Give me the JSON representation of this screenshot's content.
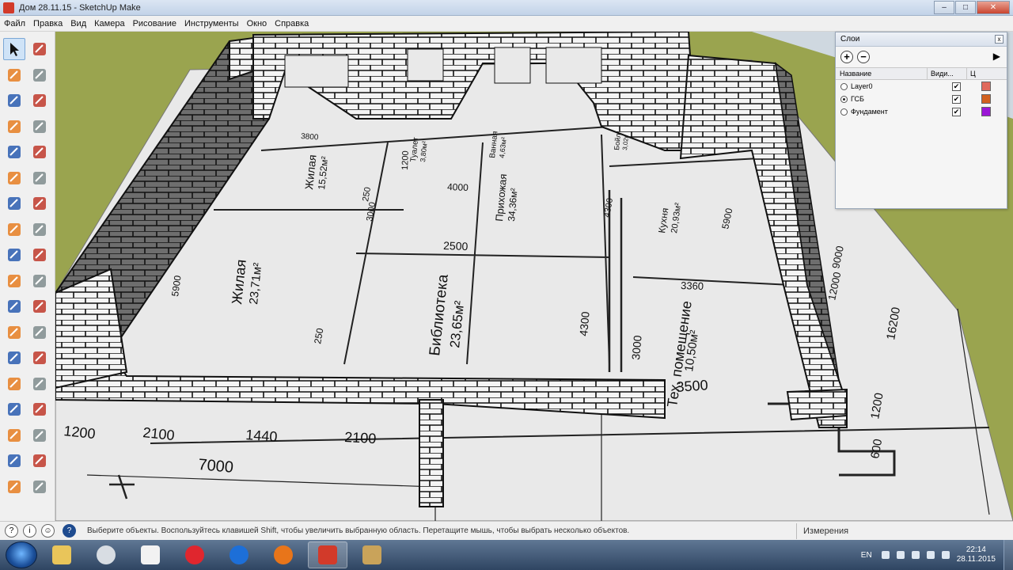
{
  "window": {
    "title": "Дом 28.11.15 - SketchUp Make",
    "buttons": [
      "–",
      "□",
      "✕"
    ]
  },
  "menu": [
    "Файл",
    "Правка",
    "Вид",
    "Камера",
    "Рисование",
    "Инструменты",
    "Окно",
    "Справка"
  ],
  "toolbar": {
    "tools": [
      "select-tool",
      "make-component-tool",
      "paint-bucket-tool",
      "eraser-tool",
      "line-tool",
      "freehand-tool",
      "rectangle-tool",
      "rotated-rectangle-tool",
      "circle-tool",
      "polygon-tool",
      "arc-tool",
      "pie-tool",
      "two-point-arc-tool",
      "three-point-arc-tool",
      "move-tool",
      "push-pull-tool",
      "rotate-tool",
      "follow-me-tool",
      "scale-tool",
      "offset-tool",
      "tape-measure-tool",
      "dimension-tool",
      "protractor-tool",
      "text-tool",
      "axes-tool",
      "3d-text-tool",
      "orbit-tool",
      "pan-tool",
      "zoom-tool",
      "zoom-window-tool",
      "zoom-extents-tool",
      "previous-view-tool",
      "position-camera-tool",
      "look-around-tool",
      "walk-tool",
      "section-plane-tool"
    ]
  },
  "plan": {
    "dims": [
      "1200",
      "2100",
      "1440",
      "2100",
      "7000",
      "3500",
      "1200",
      "600",
      "16200",
      "9000",
      "5900",
      "3360",
      "3000",
      "4300",
      "2500",
      "4000",
      "1200",
      "3800",
      "5900",
      "250",
      "250",
      "3000",
      "4300",
      "12000"
    ],
    "rooms": [
      {
        "name": "Жилая",
        "area": "15,52м²"
      },
      {
        "name": "Жилая",
        "area": "23,71м²"
      },
      {
        "name": "Библиотека",
        "area": "23,65м²"
      },
      {
        "name": "Прихожая",
        "area": "34,36м²"
      },
      {
        "name": "Кухня",
        "area": "20,93м²"
      },
      {
        "name": "Тех. помещение",
        "area": "10,50м²"
      },
      {
        "name": "Туалет",
        "area": "3,80м²"
      },
      {
        "name": "Ванная",
        "area": "4,63м²"
      },
      {
        "name": "Бойлер",
        "area": "3,02м²"
      }
    ]
  },
  "layers_panel": {
    "title": "Слои",
    "columns": {
      "name": "Название",
      "visible": "Види...",
      "color": "Ц"
    },
    "rows": [
      {
        "name": "Layer0",
        "active": false,
        "visible": "✔",
        "color": "#e06a5c"
      },
      {
        "name": "ГСБ",
        "active": true,
        "visible": "✔",
        "color": "#d2611f"
      },
      {
        "name": "Фундамент",
        "active": false,
        "visible": "✔",
        "color": "#9b16d6"
      }
    ]
  },
  "statusbar": {
    "message": "Выберите объекты. Воспользуйтесь клавишей Shift, чтобы увеличить выбранную область. Перетащите мышь, чтобы выбрать несколько объектов.",
    "measurements_label": "Измерения"
  },
  "taskbar": {
    "apps": [
      "explorer",
      "settings",
      "calendar",
      "opera",
      "teamviewer",
      "firefox",
      "sketchup",
      "tool"
    ],
    "lang": "EN",
    "time": "22:14",
    "date": "28.11.2015"
  },
  "colors": {
    "grass": "#9aa44f",
    "wall": "#f4f4f4",
    "mortar": "#111111",
    "paper": "#e9e9e9",
    "accent": "#cfe3f7"
  }
}
